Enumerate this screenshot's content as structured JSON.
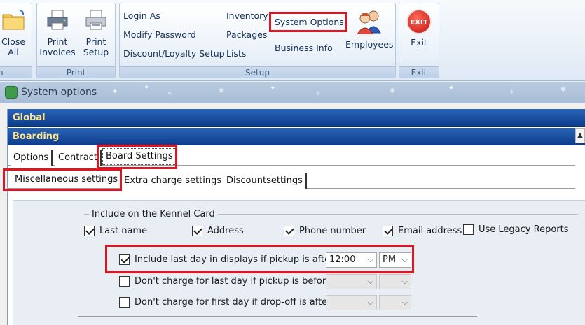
{
  "ribbon": {
    "groups": [
      {
        "label": "n"
      },
      {
        "label": "Print"
      },
      {
        "label": "Setup"
      },
      {
        "label": "Exit"
      }
    ],
    "close_all": {
      "line1": "Close",
      "line2": "All"
    },
    "print_invoices": {
      "line1": "Print",
      "line2": "Invoices"
    },
    "print_setup": {
      "line1": "Print",
      "line2": "Setup"
    },
    "setup_links": {
      "login_as": "Login As",
      "modify_password": "Modify Password",
      "discount_loyalty": "Discount/Loyalty Setup",
      "inventory": "Inventory",
      "packages": "Packages",
      "lists": "Lists",
      "system_options": "System Options",
      "business_info": "Business Info"
    },
    "employees": "Employees",
    "exit": "Exit",
    "exit_icon_text": "EXIT"
  },
  "window": {
    "title": "System options"
  },
  "sections": {
    "global": "Global",
    "boarding": "Boarding"
  },
  "tabs_level1": [
    "Options",
    "Contract",
    "Board Settings"
  ],
  "tabs_level2": [
    "Miscellaneous settings",
    "Extra charge settings",
    "Discountsettings"
  ],
  "kennel_card": {
    "legend": "Include on the Kennel Card",
    "items": [
      {
        "label": "Last name",
        "checked": true
      },
      {
        "label": "Address",
        "checked": true
      },
      {
        "label": "Phone number",
        "checked": true
      },
      {
        "label": "Email address",
        "checked": true
      },
      {
        "label": "Use Legacy Reports",
        "checked": false
      }
    ]
  },
  "options": [
    {
      "label": "Include last day in displays if pickup is after",
      "checked": true,
      "time": "12:00",
      "ampm": "PM"
    },
    {
      "label": "Don't charge for last day if pickup is before",
      "checked": false,
      "time": "",
      "ampm": ""
    },
    {
      "label": "Don't charge for first day if drop-off is after",
      "checked": false,
      "time": "",
      "ampm": ""
    }
  ],
  "colors": {
    "highlight": "#e01522",
    "section_bar": "#1a4f9e",
    "section_text": "#ffe48a"
  }
}
